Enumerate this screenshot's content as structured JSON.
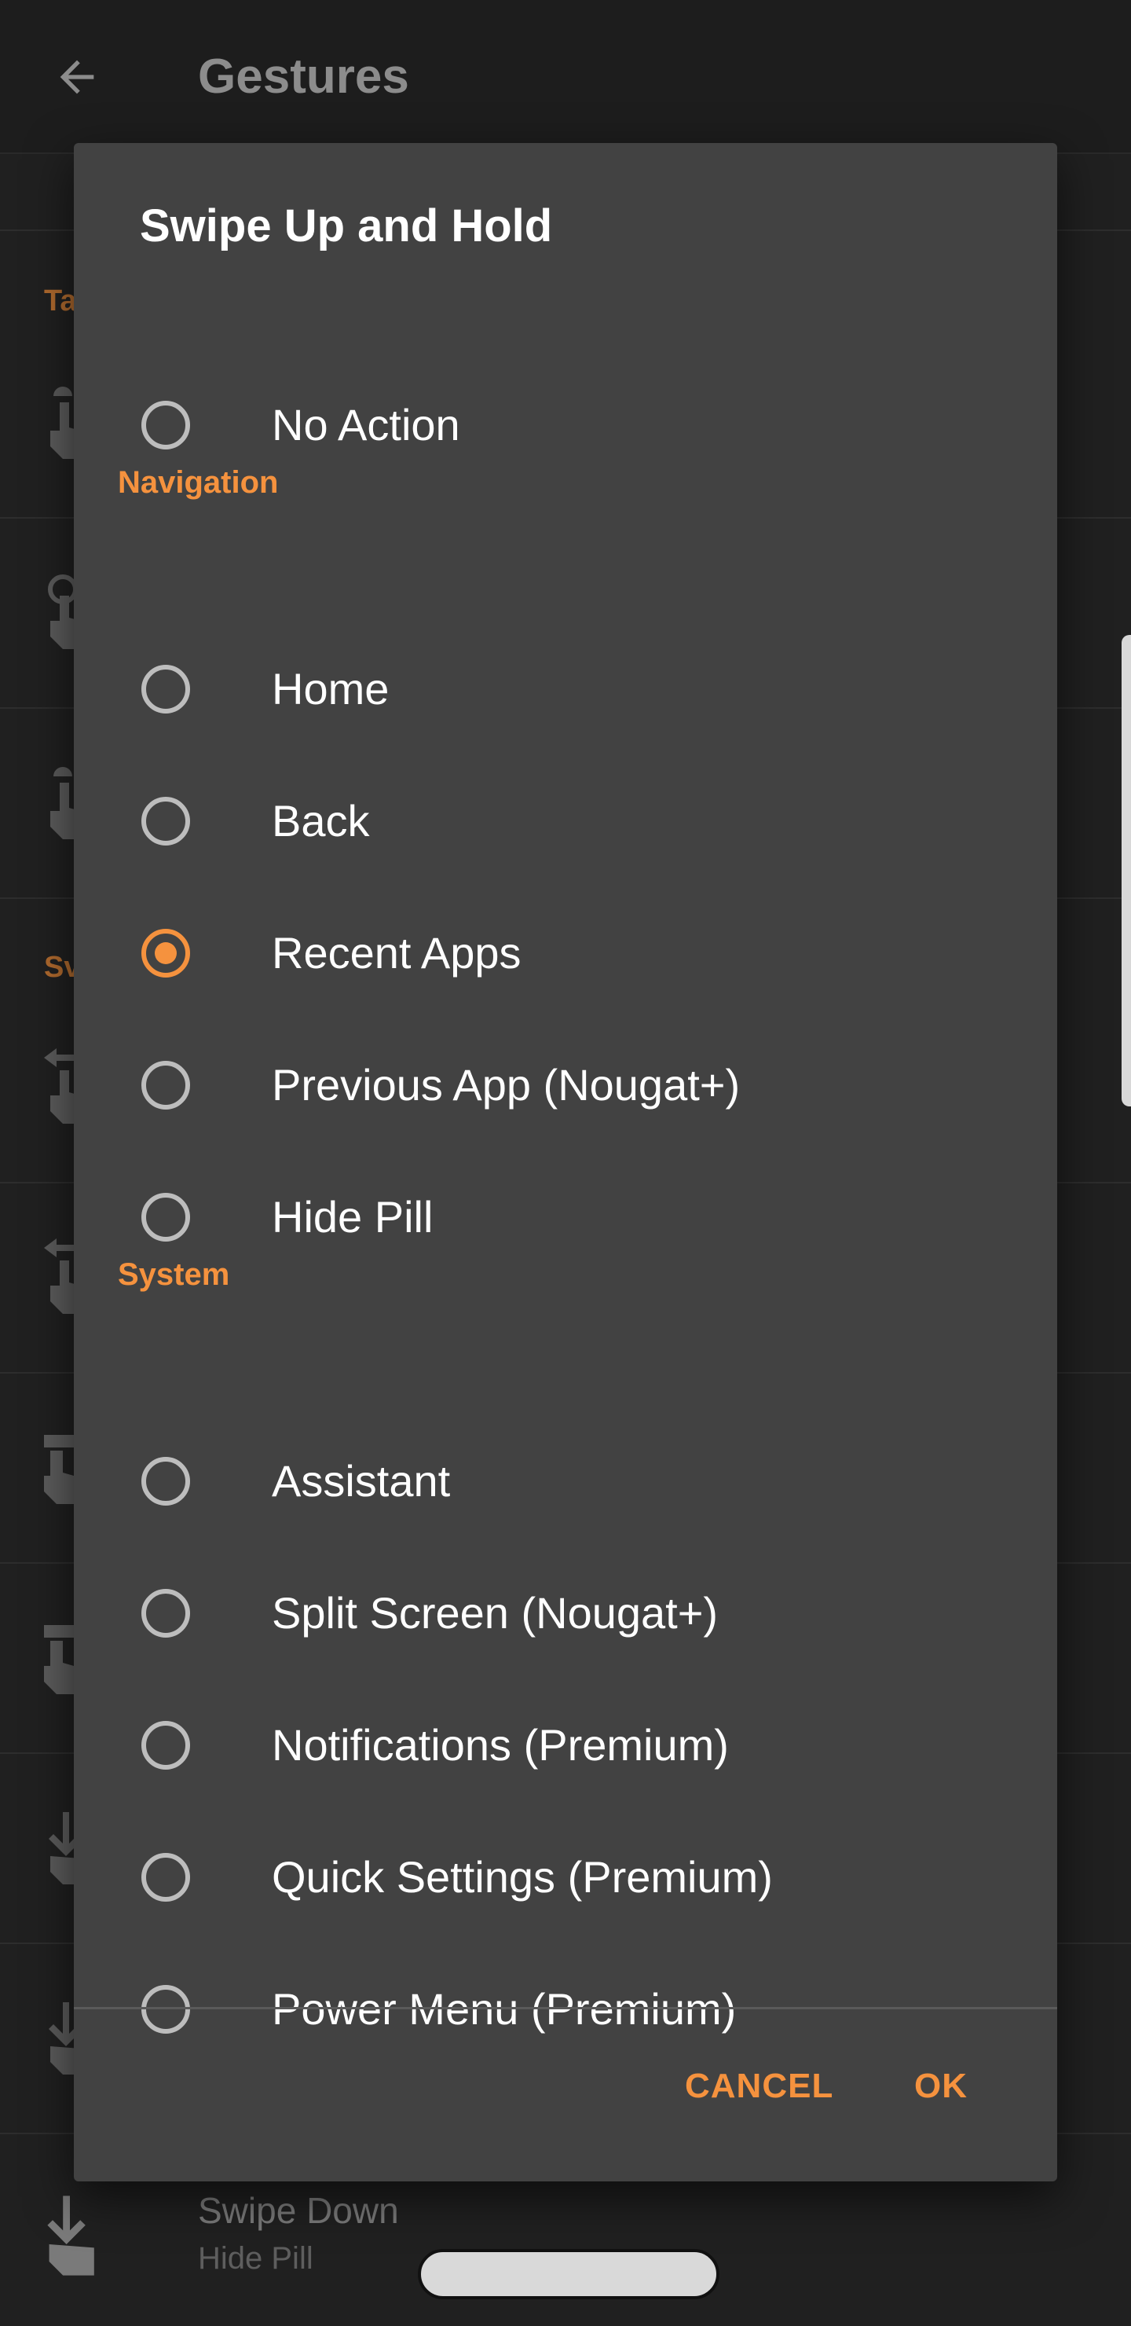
{
  "appbar": {
    "title": "Gestures"
  },
  "background": {
    "section_1_label_partial": "Ta",
    "section_2_label_partial": "Sv",
    "bottom_item": {
      "title": "Swipe Down",
      "subtitle": "Hide Pill"
    }
  },
  "dialog": {
    "title": "Swipe Up and Hold",
    "options_top": [
      {
        "label": "No Action",
        "checked": false
      }
    ],
    "sections": [
      {
        "header": "Navigation",
        "options": [
          {
            "label": "Home",
            "checked": false
          },
          {
            "label": "Back",
            "checked": false
          },
          {
            "label": "Recent Apps",
            "checked": true
          },
          {
            "label": "Previous App (Nougat+)",
            "checked": false
          },
          {
            "label": "Hide Pill",
            "checked": false
          }
        ]
      },
      {
        "header": "System",
        "options": [
          {
            "label": "Assistant",
            "checked": false
          },
          {
            "label": "Split Screen (Nougat+)",
            "checked": false
          },
          {
            "label": "Notifications (Premium)",
            "checked": false
          },
          {
            "label": "Quick Settings (Premium)",
            "checked": false
          },
          {
            "label": "Power Menu (Premium)",
            "checked": false
          }
        ]
      }
    ],
    "buttons": {
      "cancel": "CANCEL",
      "ok": "OK"
    }
  },
  "colors": {
    "accent": "#f5923e",
    "dialog_bg": "#424242",
    "screen_bg": "#202020"
  },
  "icons": {
    "back": "arrow-left-icon",
    "gesture": "hand-gesture-icon"
  }
}
